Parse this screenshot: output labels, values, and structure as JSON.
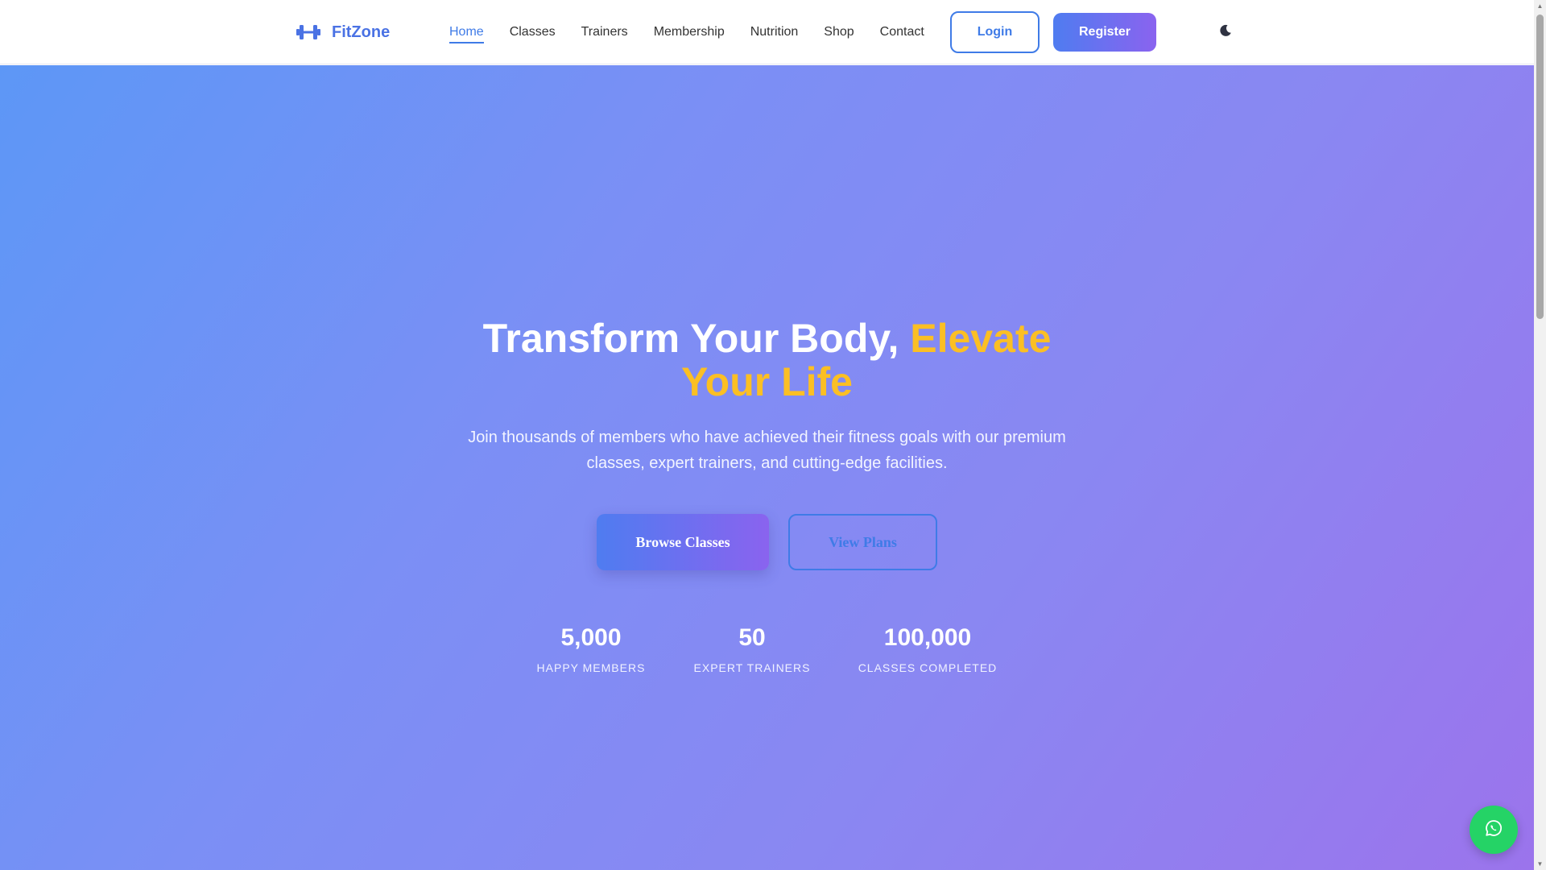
{
  "brand": {
    "name": "FitZone",
    "icon": "dumbbell-icon"
  },
  "nav": {
    "links": [
      {
        "label": "Home",
        "active": true
      },
      {
        "label": "Classes",
        "active": false
      },
      {
        "label": "Trainers",
        "active": false
      },
      {
        "label": "Membership",
        "active": false
      },
      {
        "label": "Nutrition",
        "active": false
      },
      {
        "label": "Shop",
        "active": false
      },
      {
        "label": "Contact",
        "active": false
      }
    ],
    "login_label": "Login",
    "register_label": "Register",
    "theme_icon": "moon-icon"
  },
  "hero": {
    "title_main": "Transform Your Body, ",
    "title_highlight": "Elevate Your Life",
    "subtitle": "Join thousands of members who have achieved their fitness goals with our premium classes, expert trainers, and cutting-edge facilities.",
    "primary_cta": "Browse Classes",
    "secondary_cta": "View Plans",
    "stats": [
      {
        "value": "5,000",
        "label": "HAPPY MEMBERS"
      },
      {
        "value": "50",
        "label": "EXPERT TRAINERS"
      },
      {
        "value": "100,000",
        "label": "CLASSES COMPLETED"
      }
    ]
  },
  "floating": {
    "icon": "whatsapp-icon"
  },
  "colors": {
    "primary": "#3f7be7",
    "gradient_start": "#4f7cf0",
    "gradient_end": "#8a63ef",
    "highlight": "#fbbf24",
    "whatsapp": "#25d366"
  }
}
